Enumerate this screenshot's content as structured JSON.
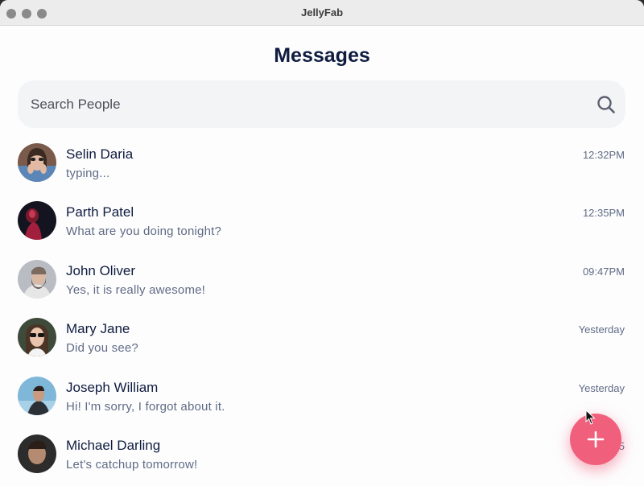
{
  "window": {
    "title": "JellyFab"
  },
  "header": {
    "title": "Messages"
  },
  "search": {
    "placeholder": "Search People"
  },
  "conversations": [
    {
      "name": "Selin Daria",
      "preview": "typing...",
      "time": "12:32PM",
      "avatar": "photo-woman-hands-face"
    },
    {
      "name": "Parth Patel",
      "preview": "What are you doing tonight?",
      "time": "12:35PM",
      "avatar": "photo-dark-red-light"
    },
    {
      "name": "John Oliver",
      "preview": "Yes, it is really awesome!",
      "time": "09:47PM",
      "avatar": "photo-man-beard-grey"
    },
    {
      "name": "Mary Jane",
      "preview": "Did you see?",
      "time": "Yesterday",
      "avatar": "photo-woman-sunglasses"
    },
    {
      "name": "Joseph William",
      "preview": "Hi! I'm sorry, I forgot about it.",
      "time": "Yesterday",
      "avatar": "photo-man-sky"
    },
    {
      "name": "Michael Darling",
      "preview": "Let's catchup tomorrow!",
      "time": "5",
      "avatar": "photo-man-beard-smile"
    }
  ],
  "fab": {
    "icon": "plus-icon",
    "color": "#f0607c"
  },
  "colors": {
    "text_primary": "#0f1c3f",
    "text_secondary": "#5f6b84",
    "search_bg": "#f3f4f6"
  }
}
